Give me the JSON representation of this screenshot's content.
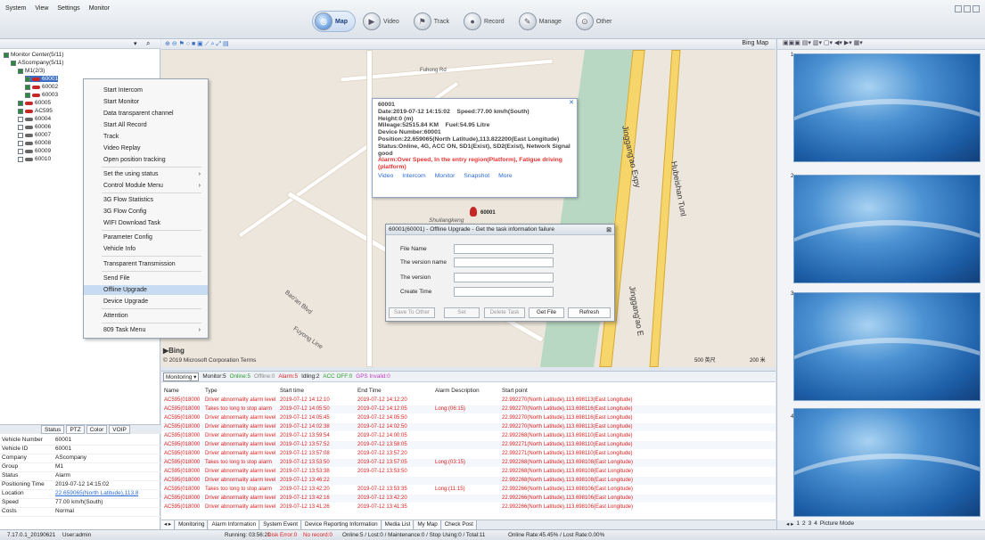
{
  "menu": [
    "System",
    "View",
    "Settings",
    "Monitor"
  ],
  "navtabs": [
    {
      "label": "Map",
      "active": true,
      "icon": "map-icon"
    },
    {
      "label": "Video",
      "icon": "video-icon"
    },
    {
      "label": "Track",
      "icon": "track-icon"
    },
    {
      "label": "Record",
      "icon": "record-icon"
    },
    {
      "label": "Manage",
      "icon": "manage-icon"
    },
    {
      "label": "Other",
      "icon": "other-icon"
    }
  ],
  "tree": [
    {
      "label": "Monitor Center(5/11)"
    },
    {
      "label": "AScompany(5/11)"
    },
    {
      "label": "M1(2/3)"
    },
    {
      "label": "60001"
    },
    {
      "label": "60002"
    },
    {
      "label": "60003"
    },
    {
      "label": "60005"
    },
    {
      "label": "AC595"
    },
    {
      "label": "60004"
    },
    {
      "label": "60006"
    },
    {
      "label": "60007"
    },
    {
      "label": "60008"
    },
    {
      "label": "60009"
    },
    {
      "label": "60010"
    }
  ],
  "context_menu": [
    {
      "label": "Start Intercom"
    },
    {
      "label": "Start Monitor"
    },
    {
      "label": "Data transparent channel"
    },
    {
      "label": "Start All Record"
    },
    {
      "label": "Track"
    },
    {
      "label": "Video Replay"
    },
    {
      "label": "Open position tracking"
    },
    {
      "label": "Set the using status",
      "submenu": true
    },
    {
      "label": "Control Module Menu",
      "submenu": true
    },
    {
      "label": "3G Flow Statistics"
    },
    {
      "label": "3G Flow Config"
    },
    {
      "label": "WIFI Download Task"
    },
    {
      "label": "Parameter Config"
    },
    {
      "label": "Vehicle Info"
    },
    {
      "label": "Transparent Transmission"
    },
    {
      "label": "Send File"
    },
    {
      "label": "Offline Upgrade",
      "selected": true
    },
    {
      "label": "Device Upgrade"
    },
    {
      "label": "Attention"
    },
    {
      "label": "809 Task Menu",
      "submenu": true
    }
  ],
  "info_tabs": [
    "Status",
    "PTZ",
    "Color",
    "VOIP"
  ],
  "info": [
    {
      "k": "Vehicle Number",
      "v": "60001"
    },
    {
      "k": "Vehicle ID",
      "v": "60001"
    },
    {
      "k": "Company",
      "v": "AScompany"
    },
    {
      "k": "Group",
      "v": "M1"
    },
    {
      "k": "Status",
      "v": "Alarm"
    },
    {
      "k": "Positioning Time",
      "v": "2019-07-12 14:15:02"
    },
    {
      "k": "Location",
      "v": "22.659065(North Latitude),113.8"
    },
    {
      "k": "Speed",
      "v": "77.00 km/h(South)"
    },
    {
      "k": "Costs",
      "v": "Normal"
    }
  ],
  "map": {
    "provider_label": "Bing Map",
    "copyright": "© 2019 Microsoft Corporation Terms",
    "bing": "Bing",
    "scale1": "500 英尺",
    "scale2": "200 米",
    "labels": [
      "Fuhong Rd",
      "Jinggang'ao Expy",
      "Hubeishan Tunl",
      "Shuilangkeng",
      "Bao'an Blvd",
      "Fuyong Line",
      "Jinggang'ao E"
    ],
    "vehicle_label": "60001"
  },
  "popup": {
    "title": "60001",
    "date": "Date:2019-07-12 14:15:02",
    "speed": "Speed:77.00 km/h(South)",
    "height": "Height:0 (m)",
    "mileage": "Mileage:52515.84 KM",
    "fuel": "Fuel:54.95 Litre",
    "device": "Device Number:60001",
    "position": "Position:22.659065(North Latitude),113.822200(East Longitude)",
    "status": "Status:Online, 4G, ACC ON, SD1(Exist), SD2(Exist), Network Signal good",
    "alarm": "Alarm:Over Speed, In the entry region(Platform), Fatigue driving (platform)",
    "links": [
      "Video",
      "Intercom",
      "Monitor",
      "Snapshot",
      "More"
    ]
  },
  "dialog": {
    "title": "60001(60001) - Offline Upgrade - Get the task information failure",
    "fields": [
      "File Name",
      "The version name",
      "The version",
      "Create Time"
    ],
    "buttons": [
      "Save To Other",
      "Set",
      "Delete Task",
      "Get File",
      "Refresh"
    ]
  },
  "monitor_bar": {
    "button": "Monitoring",
    "stats": [
      "Monitor:5",
      "Online:5",
      "Offline:0",
      "Alarm:5",
      "Idling:2",
      "ACC OFF:0",
      "GPS Invalid:0"
    ]
  },
  "table": {
    "headers": [
      "Name",
      "Type",
      "Start time",
      "End Time",
      "Alarm Description",
      "Start point"
    ],
    "rows": [
      [
        "AC595(018000",
        "Driver abnormality alarm level",
        "2019-07-12 14:12:10",
        "2019-07-12 14:12:20",
        "",
        "22.992270(North Latitude),113.698113(East Longitude)"
      ],
      [
        "AC595(018000",
        "Takes too long to stop alarm",
        "2019-07-12 14:05:50",
        "2019-07-12 14:12:05",
        "Long:(06:15)",
        "22.992270(North Latitude),113.698116(East Longitude)"
      ],
      [
        "AC595(018000",
        "Driver abnormality alarm level",
        "2019-07-12 14:05:45",
        "2019-07-12 14:05:50",
        "",
        "22.992270(North Latitude),113.698116(East Longitude)"
      ],
      [
        "AC595(018000",
        "Driver abnormality alarm level",
        "2019-07-12 14:02:38",
        "2019-07-12 14:02:50",
        "",
        "22.992270(North Latitude),113.698113(East Longitude)"
      ],
      [
        "AC595(018000",
        "Driver abnormality alarm level",
        "2019-07-12 13:59:54",
        "2019-07-12 14:00:05",
        "",
        "22.992268(North Latitude),113.698110(East Longitude)"
      ],
      [
        "AC595(018000",
        "Driver abnormality alarm level",
        "2019-07-12 13:57:52",
        "2019-07-12 13:58:05",
        "",
        "22.992271(North Latitude),113.698110(East Longitude)"
      ],
      [
        "AC595(018000",
        "Driver abnormality alarm level",
        "2019-07-12 13:57:08",
        "2019-07-12 13:57:20",
        "",
        "22.992271(North Latitude),113.698110(East Longitude)"
      ],
      [
        "AC595(018000",
        "Takes too long to stop alarm",
        "2019-07-12 13:53:50",
        "2019-07-12 13:57:05",
        "Long:(03:15)",
        "22.992268(North Latitude),113.698108(East Longitude)"
      ],
      [
        "AC595(018000",
        "Driver abnormality alarm level",
        "2019-07-12 13:53:38",
        "2019-07-12 13:53:50",
        "",
        "22.992268(North Latitude),113.698108(East Longitude)"
      ],
      [
        "AC595(018000",
        "Driver abnormality alarm level",
        "2019-07-12 13:46:22",
        "",
        "",
        "22.992268(North Latitude),113.698108(East Longitude)"
      ],
      [
        "AC595(018000",
        "Takes too long to stop alarm",
        "2019-07-12 13:42:20",
        "2019-07-12 13:53:35",
        "Long:(11:15)",
        "22.992266(North Latitude),113.698106(East Longitude)"
      ],
      [
        "AC595(018000",
        "Driver abnormality alarm level",
        "2019-07-12 13:42:16",
        "2019-07-12 13:42:20",
        "",
        "22.992266(North Latitude),113.698106(East Longitude)"
      ],
      [
        "AC595(018000",
        "Driver abnormality alarm level",
        "2019-07-12 13:41:26",
        "2019-07-12 13:41:35",
        "",
        "22.992266(North Latitude),113.698106(East Longitude)"
      ]
    ]
  },
  "bottom_tabs": [
    "Monitoring",
    "Alarm Information",
    "System Event",
    "Device Reporting Information",
    "Media List",
    "My Map",
    "Check Post"
  ],
  "right_tiles": [
    "1",
    "2",
    "3",
    "4"
  ],
  "right_tabs": [
    "1",
    "2",
    "3",
    "4",
    "Picture Mode"
  ],
  "status": {
    "version": "7.17.0.1_20190621",
    "user": "User:admin",
    "running": "Running: 03:56:21",
    "disk": "Disk Error:0",
    "record": "No record:0",
    "summary": "Online:5 / Lost:0 / Maintenance:0 / Stop Using:0 / Total:11",
    "rate": "Online Rate:45.45% / Lost Rate:0.00%"
  },
  "colors": {
    "accent": "#2a6bd6",
    "alarm": "#d22222",
    "selected": "#c7dcf3"
  }
}
